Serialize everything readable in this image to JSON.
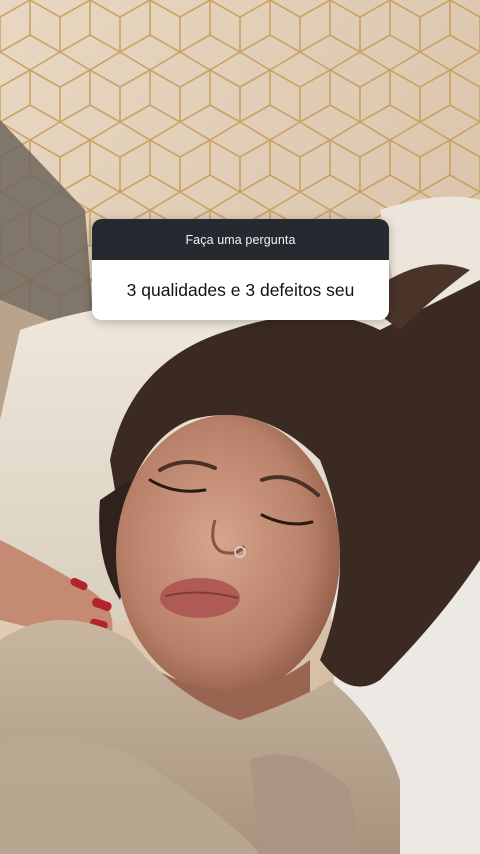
{
  "question_sticker": {
    "header": "Faça uma pergunta",
    "question": "3 qualidades e 3 defeitos seu"
  },
  "colors": {
    "sticker_header_bg": "#262a30",
    "sticker_header_text": "#f2f2f2",
    "sticker_body_bg": "#ffffff",
    "sticker_body_text": "#111111"
  }
}
